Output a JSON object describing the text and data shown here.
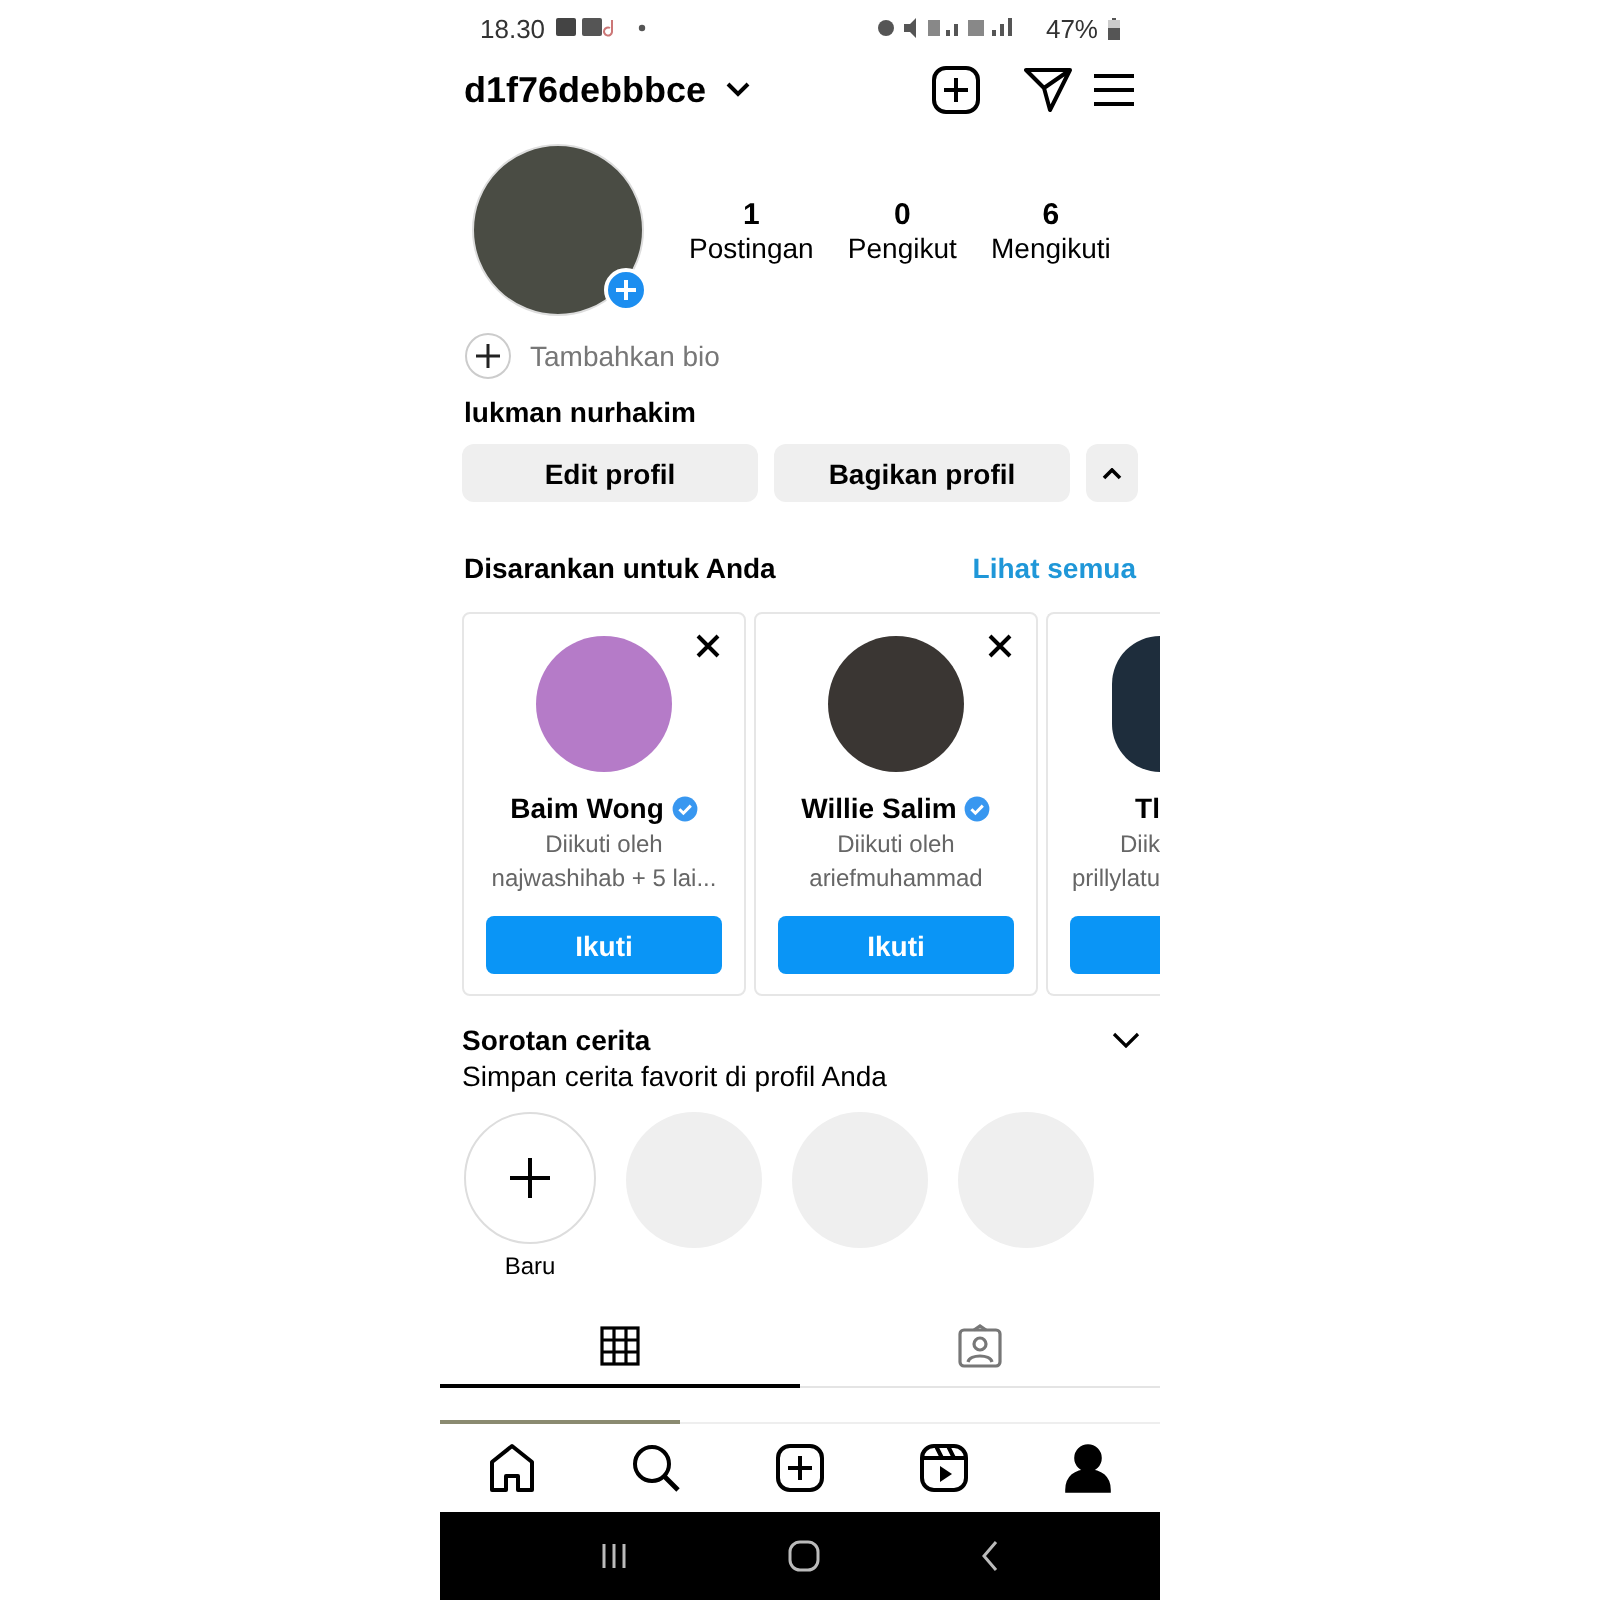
{
  "status_bar": {
    "time": "18.30",
    "battery": "47%"
  },
  "header": {
    "username": "d1f76debbbce"
  },
  "profile": {
    "stats": [
      {
        "count": "1",
        "label": "Postingan"
      },
      {
        "count": "0",
        "label": "Pengikut"
      },
      {
        "count": "6",
        "label": "Mengikuti"
      }
    ],
    "add_bio": "Tambahkan bio",
    "full_name": "lukman nurhakim"
  },
  "buttons": [
    "Edit profil",
    "Bagikan profil"
  ],
  "suggestions": {
    "title": "Disarankan untuk Anda",
    "see_all": "Lihat semua",
    "cards": [
      {
        "kind": "full",
        "name": "Baim Wong",
        "verified": true,
        "line1": "Diikuti oleh",
        "line2": "najwashihab + 5 lai...",
        "button": "Ikuti"
      },
      {
        "kind": "full",
        "name": "Willie Salim",
        "verified": true,
        "line1": "Diikuti oleh",
        "line2": "ariefmuhammad",
        "button": "Ikuti"
      },
      {
        "kind": "partial",
        "name": "Tl",
        "verified": false,
        "line1": "Diik",
        "line2": "prillylatu"
      }
    ]
  },
  "highlights": {
    "title": "Sorotan cerita",
    "subtitle": "Simpan cerita favorit di profil Anda",
    "new_label": "Baru"
  },
  "tabs": [
    {
      "kind": "grid",
      "selected": true
    },
    {
      "kind": "tagged",
      "selected": false
    }
  ],
  "bottom_nav": [
    {
      "kind": "home",
      "selected": false
    },
    {
      "kind": "search",
      "selected": false
    },
    {
      "kind": "create",
      "selected": false
    },
    {
      "kind": "reels",
      "selected": false
    },
    {
      "kind": "profile",
      "selected": true
    }
  ]
}
